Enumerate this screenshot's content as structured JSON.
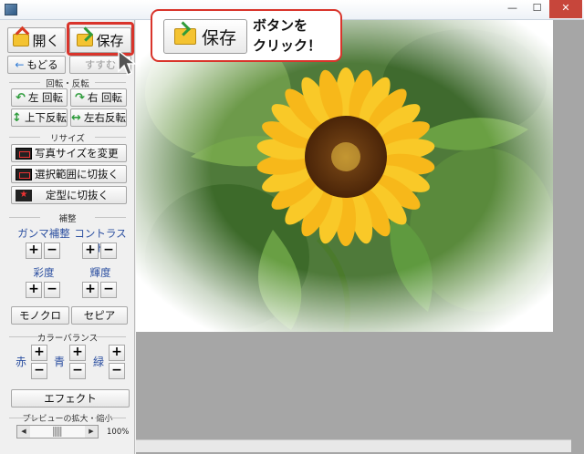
{
  "panel": {
    "open_label": "開く",
    "save_label": "保存",
    "back_label": "もどる",
    "forward_label": "すすむ",
    "rotate_legend": "回転・反転",
    "rotate_left": "左 回転",
    "rotate_right": "右 回転",
    "flip_vertical": "上下反転",
    "flip_horizontal": "左右反転",
    "resize_legend": "リサイズ",
    "change_size": "写真サイズを変更",
    "crop_selection": "選択範囲に切抜く",
    "crop_shape": "定型に切抜く",
    "correction_legend": "補整",
    "gamma_label": "ガンマ補整",
    "contrast_label": "コントラスト",
    "saturation_label": "彩度",
    "brightness_label": "輝度",
    "plus": "+",
    "minus": "−",
    "mono_label": "モノクロ",
    "sepia_label": "セピア",
    "color_balance_legend": "カラーバランス",
    "red_label": "赤",
    "blue_label": "青",
    "green_label": "緑",
    "effect_label": "エフェクト",
    "preview_legend": "プレビューの拡大・縮小",
    "zoom_value": "100%",
    "zoom_fraction": 0.5
  },
  "callout": {
    "save_label": "保存",
    "text_line1": "ボタンを",
    "text_line2": "クリック！"
  },
  "window": {
    "minimize": "—",
    "maximize": "☐",
    "close": "✕"
  },
  "colors": {
    "accent": "#d9342b",
    "label_blue": "#2b4fa0",
    "work_bg": "#a6a6a6"
  }
}
